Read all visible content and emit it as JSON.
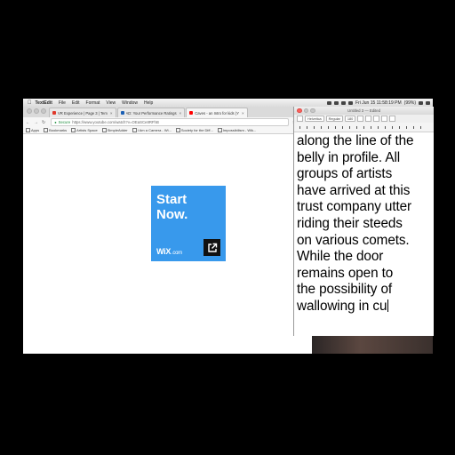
{
  "menubar": {
    "apple": "",
    "items": [
      "TextEdit",
      "File",
      "Edit",
      "Format",
      "View",
      "Window",
      "Help"
    ],
    "clock": "Fri Jun 15  11:58:19 PM",
    "battery": "(99%)"
  },
  "chrome": {
    "tabs": [
      {
        "label": "VR Experience | Page 3 | Tem",
        "color": "#e0392b",
        "active": false
      },
      {
        "label": "AD: Your Performance Ratings",
        "color": "#1a5fb4",
        "active": false
      },
      {
        "label": "Caves - an Intro for kids (Y",
        "color": "#ff0000",
        "active": true
      }
    ],
    "omnibox": {
      "secure_label": "Secure",
      "url": "https://www.youtube.com/watch?v=OEaSCe8RFhB"
    },
    "bookmarks": [
      "Apps",
      "Bookmarks",
      "Artists Space",
      "SimpleAdder",
      "I Am a Camera - Wi...",
      "Society for the Diff...",
      "Impossibilism - Wik..."
    ]
  },
  "ad": {
    "headline": "Start Now.",
    "brand": "WiX",
    "domain": ".com",
    "color": "#3899ec"
  },
  "textedit": {
    "title": "Untitled 3 — Edited",
    "font_popup": "Helvetica",
    "style_popup": "Regular",
    "size_popup": "180",
    "lines": [
      "along the line of the",
      "belly in profile. All",
      "groups of artists",
      "have arrived at this",
      "trust company utter",
      "riding their steeds",
      "on various comets.",
      "While the door",
      "remains open to",
      "the possibility of",
      "wallowing in cu"
    ]
  }
}
